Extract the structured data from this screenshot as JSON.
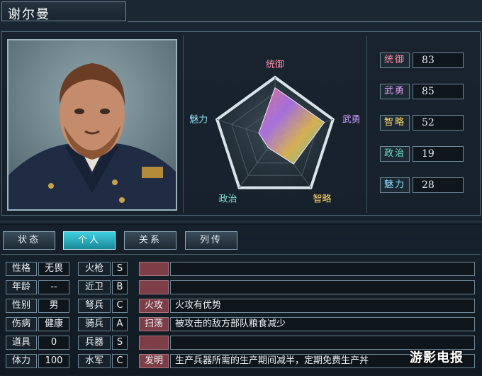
{
  "title": "谢尔曼",
  "radar": {
    "axes": [
      "统御",
      "武勇",
      "智略",
      "政治",
      "魅力"
    ],
    "values": [
      83,
      85,
      52,
      19,
      28
    ],
    "max": 100,
    "axis_colors": [
      "#ff8fa8",
      "#c99bff",
      "#ffd76a",
      "#7fe6d1",
      "#8ee0f2"
    ]
  },
  "stats": [
    {
      "label": "统御",
      "value": "83",
      "color": "#ff8fa8"
    },
    {
      "label": "武勇",
      "value": "85",
      "color": "#d99cf0"
    },
    {
      "label": "智略",
      "value": "52",
      "color": "#ffd76a"
    },
    {
      "label": "政治",
      "value": "19",
      "color": "#6fe2c6"
    },
    {
      "label": "魅力",
      "value": "28",
      "color": "#8fe0ff"
    }
  ],
  "tabs": [
    {
      "label": "状态",
      "active": false
    },
    {
      "label": "个人",
      "active": true
    },
    {
      "label": "关系",
      "active": false
    },
    {
      "label": "列传",
      "active": false
    }
  ],
  "personal": [
    {
      "label": "性格",
      "value": "无畏"
    },
    {
      "label": "年龄",
      "value": "--"
    },
    {
      "label": "性别",
      "value": "男"
    },
    {
      "label": "伤病",
      "value": "健康"
    },
    {
      "label": "道具",
      "value": "0"
    },
    {
      "label": "体力",
      "value": "100"
    }
  ],
  "aptitude": [
    {
      "label": "火枪",
      "grade": "S"
    },
    {
      "label": "近卫",
      "grade": "B"
    },
    {
      "label": "弩兵",
      "grade": "C"
    },
    {
      "label": "骑兵",
      "grade": "A"
    },
    {
      "label": "兵器",
      "grade": "S"
    },
    {
      "label": "水军",
      "grade": "C"
    }
  ],
  "skills": [
    {
      "name": "",
      "desc": ""
    },
    {
      "name": "",
      "desc": ""
    },
    {
      "name": "火攻",
      "desc": "火攻有优势"
    },
    {
      "name": "扫荡",
      "desc": "被攻击的敌方部队粮食减少"
    },
    {
      "name": "",
      "desc": ""
    },
    {
      "name": "发明",
      "desc": "生产兵器所需的生产期间减半，定期免费生产丼"
    }
  ],
  "watermark": "游影电报"
}
